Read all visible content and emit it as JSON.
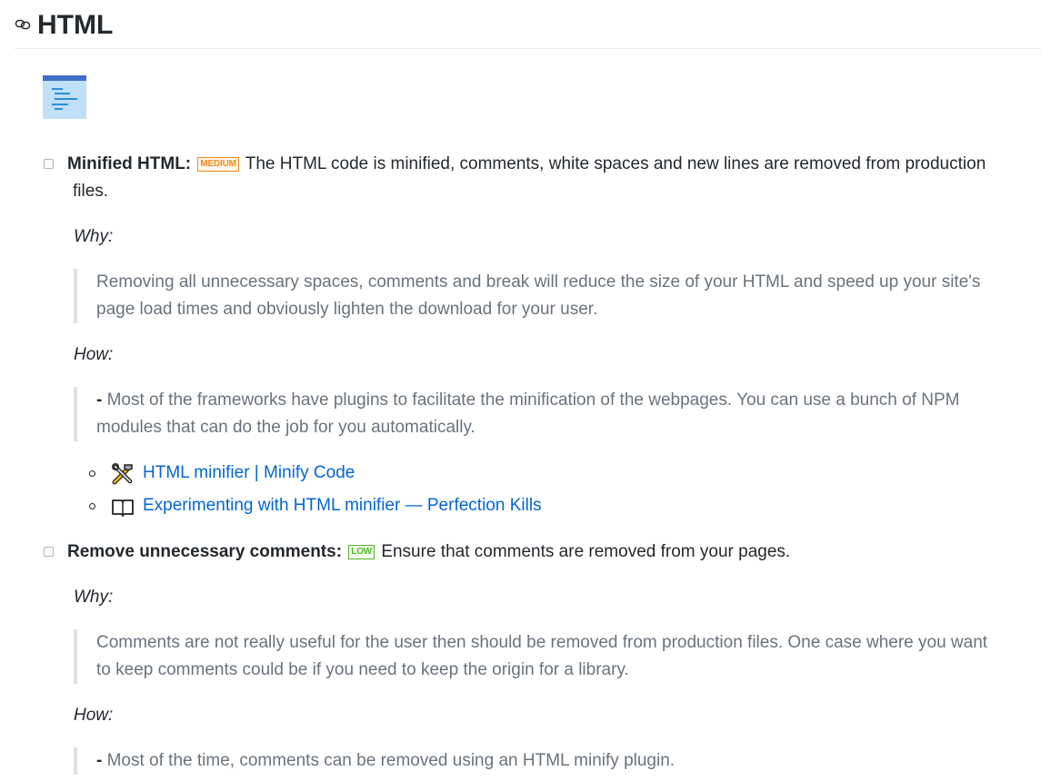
{
  "section": {
    "title": "HTML",
    "anchor_icon": "link-icon",
    "hero_icon": "document-lines-icon"
  },
  "items": [
    {
      "label": "Minified HTML:",
      "badge": "MEDIUM",
      "badge_color": "#f08c1c",
      "description_line1": "The HTML code is minified, comments, white spaces and new lines are removed from production",
      "description_line2": "files.",
      "why_label": "Why:",
      "why_line1": "Removing all unnecessary spaces, comments and break will reduce the size of your HTML and speed up your site's",
      "why_line2": "page load times and obviously lighten the download for your user.",
      "how_label": "How:",
      "how_dash": "-",
      "how_line1": "Most of the frameworks have plugins to facilitate the minification of the webpages. You can use a bunch of NPM",
      "how_line2": "modules that can do the job for you automatically.",
      "links": [
        {
          "icon": "tools-icon",
          "text": "HTML minifier | Minify Code"
        },
        {
          "icon": "book-icon",
          "text": "Experimenting with HTML minifier — Perfection Kills"
        }
      ]
    },
    {
      "label": "Remove unnecessary comments:",
      "badge": "LOW",
      "badge_color": "#52b52c",
      "description_line1": "Ensure that comments are removed from your pages.",
      "why_label": "Why:",
      "why_line1": "Comments are not really useful for the user then should be removed from production files. One case where you want",
      "why_line2": "to keep comments could be if you need to keep the origin for a library.",
      "how_label": "How:",
      "how_dash": "-",
      "how_line1": "Most of the time, comments can be removed using an HTML minify plugin."
    }
  ]
}
